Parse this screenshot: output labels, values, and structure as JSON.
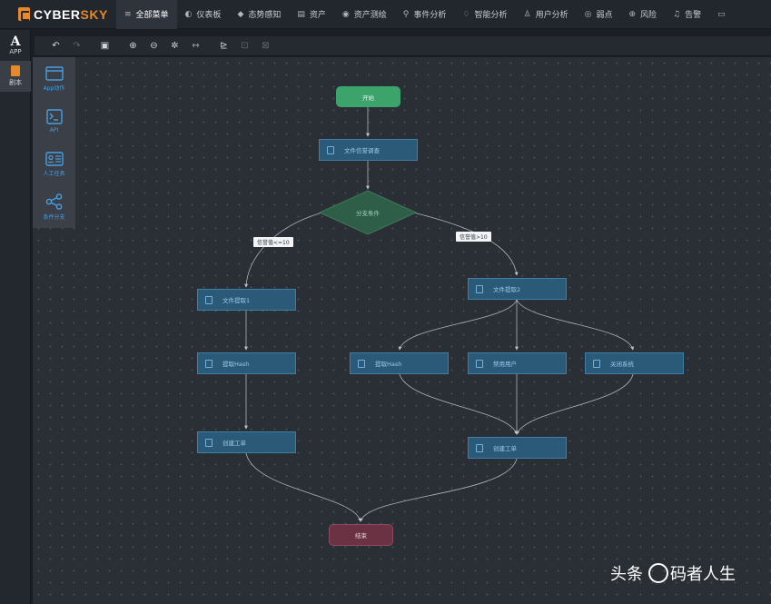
{
  "app": {
    "logo_prefix": "CYBER",
    "logo_suffix": "SKY"
  },
  "nav": [
    {
      "icon": "≡",
      "label": "全部菜单",
      "active": true
    },
    {
      "icon": "◐",
      "label": "仪表板"
    },
    {
      "icon": "◆",
      "label": "态势感知"
    },
    {
      "icon": "▤",
      "label": "资产"
    },
    {
      "icon": "◉",
      "label": "资产测绘"
    },
    {
      "icon": "⚲",
      "label": "事件分析"
    },
    {
      "icon": "♢",
      "label": "智能分析"
    },
    {
      "icon": "♙",
      "label": "用户分析"
    },
    {
      "icon": "◎",
      "label": "弱点"
    },
    {
      "icon": "⊕",
      "label": "风险"
    },
    {
      "icon": "♫",
      "label": "告警"
    },
    {
      "icon": "▭",
      "label": ""
    }
  ],
  "rail": [
    {
      "glyph": "A",
      "label": "APP"
    },
    {
      "label": "剧本",
      "active": true
    }
  ],
  "toolbar": {
    "icons": [
      "↶",
      "↷",
      "▣",
      "⊕",
      "⊖",
      "✲",
      "⇿",
      "⊵",
      "⊡",
      "⊠"
    ]
  },
  "palette": [
    {
      "label": "App动作",
      "icon": "app-window-icon"
    },
    {
      "label": "API",
      "icon": "terminal-icon"
    },
    {
      "label": "人工任务",
      "icon": "id-card-icon"
    },
    {
      "label": "条件分支",
      "icon": "share-icon"
    }
  ],
  "flow": {
    "start": "开始",
    "n_reputation": "文件信誉调查",
    "decision": "分支条件",
    "label_left": "信誉值<=10",
    "label_right": "信誉值>10",
    "n_extract1": "文件提取1",
    "n_extract2": "文件提取2",
    "n_hash_left": "提取Hash",
    "n_hash_right": "提取Hash",
    "n_disable_user": "禁用用户",
    "n_shutdown": "关闭系统",
    "n_ticket_left": "创建工单",
    "n_ticket_right": "创建工单",
    "end": "结束"
  },
  "watermark": {
    "prefix": "头条",
    "name": "码者人生"
  },
  "colors": {
    "accent": "#e6892a",
    "task": "#2a5a78",
    "start": "#3ca36a",
    "end": "#6b3244",
    "decision": "#2e5e48"
  }
}
